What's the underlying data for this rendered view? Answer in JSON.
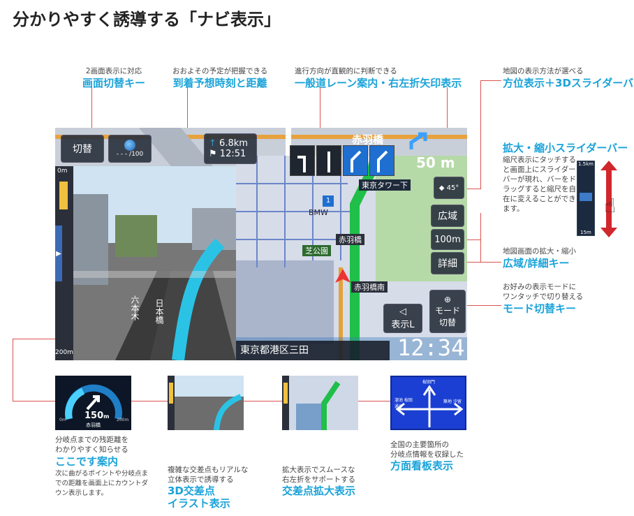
{
  "title": "分かりやすく誘導する「ナビ表示」",
  "callouts": {
    "screen_switch": {
      "desc": "2画面表示に対応",
      "name": "画面切替キー"
    },
    "arrival": {
      "desc": "おおよその予定が把握できる",
      "name": "到着予想時刻と距離"
    },
    "lane": {
      "desc": "進行方向が直観的に判断できる",
      "name": "一般道レーン案内・右左折矢印表示"
    },
    "heading": {
      "desc": "地図の表示方法が選べる",
      "name": "方位表示＋3Dスライダーバー"
    },
    "zoom_slider": {
      "name": "拡大・縮小スライダーバー",
      "desc_lines": [
        "縮尺表示にタッチする",
        "と画面上にスライダー",
        "バーが現れ、バーをド",
        "ラッグすると縮尺を自",
        "在に変えることができ",
        "ます。"
      ]
    },
    "wide_detail": {
      "desc": "地図画面の拡大・縮小",
      "name": "広域/詳細キー"
    },
    "mode": {
      "desc_lines": [
        "お好みの表示モードに",
        "ワンタッチで切り替える"
      ],
      "name": "モード切替キー"
    }
  },
  "screen": {
    "switch_label": "切替",
    "gauge_text": "- - - /100",
    "distance": "6.8km",
    "eta": "12:51",
    "junction_name": "赤羽橋",
    "junction_distance": "50 m",
    "scale_top": "0m",
    "scale_bottom": "200m",
    "tokyo_tower": "東京タワー下",
    "bmw": "BMW",
    "shiba_park": "芝公園",
    "akabanebashi": "赤羽橋",
    "akabanebashi_minami": "赤羽橋南",
    "roku_hongi": "六本木",
    "nihonbashi": "日本橋",
    "heading_deg": "45°",
    "btn_wide": "広域",
    "btn_scale": "100m",
    "btn_detail": "詳細",
    "btn_display": "表示L",
    "btn_mode_1": "モード",
    "btn_mode_2": "切替",
    "address": "東京都港区三田",
    "clock": "12:34",
    "route_no": "1",
    "slider_top": "1.5km",
    "slider_bottom": "15m"
  },
  "thumbs": {
    "koko": {
      "distance": "150",
      "unit": "m",
      "place": "赤羽橋",
      "left_scale": "0m",
      "right_scale": "200m",
      "caption": [
        "分岐点までの残距離を",
        "わかりやすく知らせる"
      ],
      "title": "ここです案内",
      "note": [
        "次に曲がるポイントや分岐点ま",
        "での距離を画面上にカウントダ",
        "ウン表示します。"
      ]
    },
    "illust": {
      "caption": [
        "複雑な交差点もリアルな",
        "立体表示で誘導する"
      ],
      "title_lines": [
        "3D交差点",
        "イラスト表示"
      ]
    },
    "enlarge": {
      "caption": [
        "拡大表示でスムースな",
        "右左折をサポートする"
      ],
      "title": "交差点拡大表示"
    },
    "signboard": {
      "top": "桜田門",
      "left": "溜池 桜田通り",
      "right": "築地 汐留",
      "caption": [
        "全国の主要箇所の",
        "分岐点情報を収録した"
      ],
      "title": "方面看板表示"
    }
  },
  "colors": {
    "accent": "#1aa3d9",
    "lead": "#d9534f",
    "route": "#27c24c",
    "lane_active": "#1e6fd0"
  }
}
